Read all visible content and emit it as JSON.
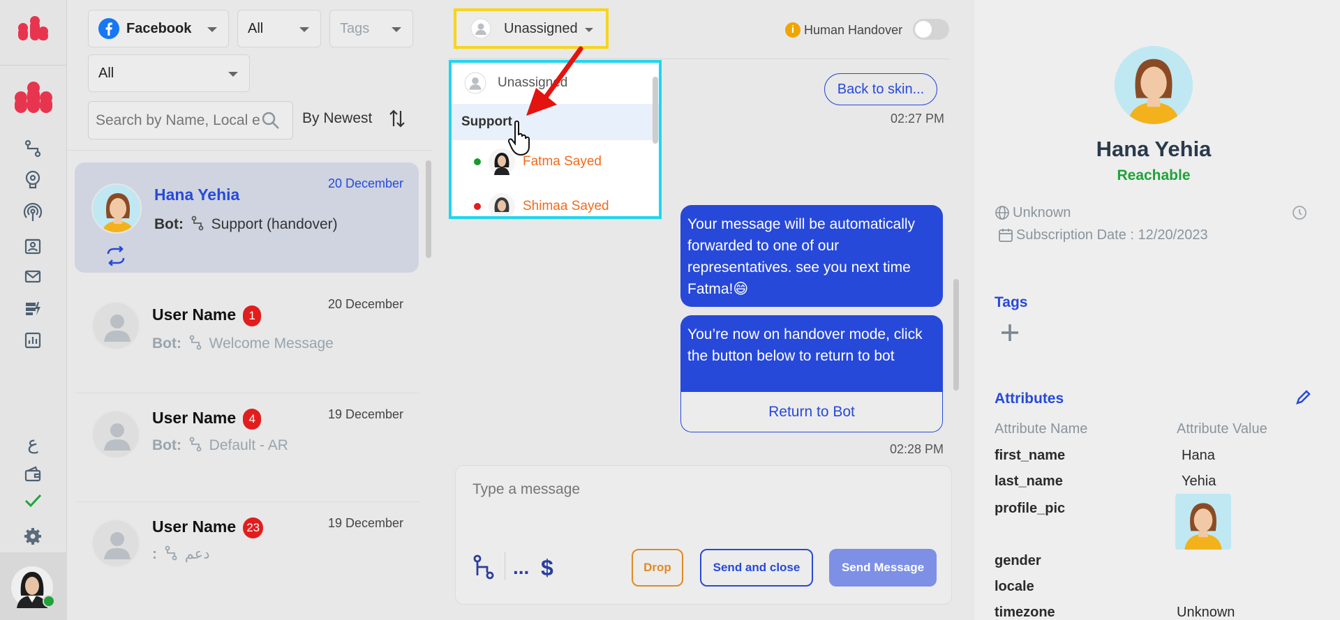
{
  "filters": {
    "channel": "Facebook",
    "status": "All",
    "tags_placeholder": "Tags",
    "assignee_filter": "All",
    "search_placeholder": "Search by Name, Local e",
    "sort_label": "By Newest"
  },
  "conversations": [
    {
      "name": "Hana Yehia",
      "date": "20 December",
      "bot_prefix": "Bot:",
      "flow": "Support (handover)"
    },
    {
      "name": "User Name",
      "badge": "1",
      "date": "20 December",
      "bot_prefix": "Bot:",
      "flow": "Welcome Message"
    },
    {
      "name": "User Name",
      "badge": "4",
      "date": "19 December",
      "bot_prefix": "Bot:",
      "flow": "Default - AR"
    },
    {
      "name": "User Name",
      "badge": "23",
      "date": "19 December",
      "bot_prefix": ":",
      "flow": "دعم"
    }
  ],
  "chat_header": {
    "assignee": "Unassigned",
    "human_handover_label": "Human Handover",
    "human_handover_on": false
  },
  "assign_menu": {
    "unassigned": "Unassigned",
    "group": "Support",
    "agents": [
      {
        "name": "Fatma Sayed",
        "status_color": "#1a9a2a"
      },
      {
        "name": "Shimaa Sayed",
        "status_color": "#e21d1d"
      }
    ]
  },
  "messages": {
    "back_button": "Back to skin...",
    "time1": "02:27 PM",
    "bubble1": "Your message will be automatically forwarded to one of our representatives. see you next time Fatma!😄",
    "bubble2": "You’re now on handover mode, click the button below to return to bot",
    "return_button": "Return to Bot",
    "time2": "02:28 PM"
  },
  "composer": {
    "placeholder": "Type a message",
    "dots": "...",
    "dollar": "$",
    "drop": "Drop",
    "send_close": "Send and close",
    "send": "Send Message"
  },
  "profile": {
    "name": "Hana Yehia",
    "status": "Reachable",
    "location": "Unknown",
    "subscription": "Subscription Date : 12/20/2023",
    "tags_title": "Tags",
    "attributes_title": "Attributes",
    "attr_name_header": "Attribute Name",
    "attr_value_header": "Attribute Value",
    "attributes": [
      {
        "name": "first_name",
        "value": "Hana"
      },
      {
        "name": "last_name",
        "value": "Yehia"
      },
      {
        "name": "profile_pic",
        "value": ""
      },
      {
        "name": "gender",
        "value": ""
      },
      {
        "name": "locale",
        "value": ""
      },
      {
        "name": "timezone",
        "value": "Unknown"
      }
    ]
  },
  "colors": {
    "accent": "#2749d9",
    "reachable": "#1fa33a",
    "highlight_yellow": "#f7d51b",
    "highlight_cyan": "#1ed6f0",
    "agent_orange": "#f26a1b"
  }
}
